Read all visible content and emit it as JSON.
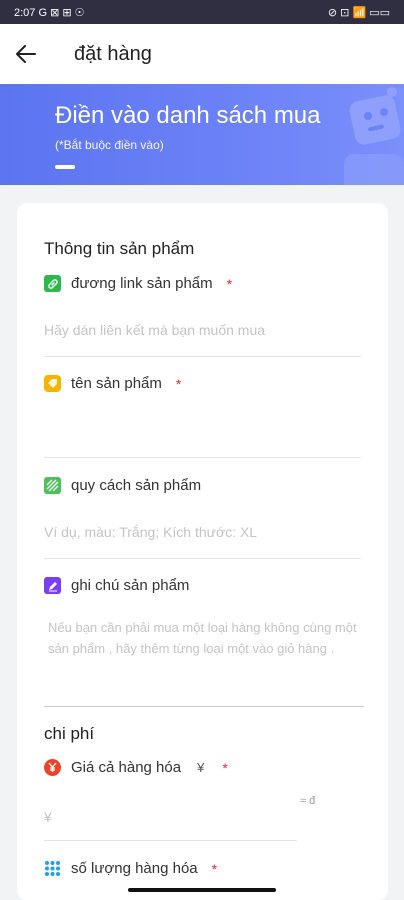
{
  "status_bar": {
    "left": "2:07 G ⊠ ⊞ ☉",
    "right": "⊘ ⊡ 📶 ▭▭"
  },
  "header": {
    "title": "đặt hàng"
  },
  "banner": {
    "title": "Điền vào danh sách mua",
    "subtitle": "(*Bắt buộc điền vào)"
  },
  "product_section": {
    "title": "Thông tin sản phẩm",
    "link": {
      "label": "đương link sản phẩm",
      "required": "*",
      "placeholder": "Hãy dán liên kết mà bạn muốn mua"
    },
    "name": {
      "label": "tên sản phẩm",
      "required": "*",
      "value": ""
    },
    "spec": {
      "label": "quy cách sản phẩm",
      "placeholder": "Ví dụ, màu: Trắng; Kích thước: XL"
    },
    "note": {
      "label": "ghi chú sản phẩm",
      "placeholder": "Nếu bạn cần phải mua một loại hàng không cùng một sản phẩm , hãy thêm từng loại một vào giỏ hàng ."
    }
  },
  "cost_section": {
    "title": "chi phí",
    "price": {
      "label": "Giá cả hàng hóa",
      "currency": "¥",
      "required": "*",
      "placeholder": "¥",
      "approx": "≈ đ"
    },
    "quantity": {
      "label": "số lượng hàng hóa",
      "required": "*"
    }
  },
  "colors": {
    "banner": "#6c82f7",
    "link_icon": "#2db84d",
    "name_icon": "#f5b400",
    "spec_icon": "#4cc05a",
    "note_icon": "#7b3ff2",
    "price_icon": "#e8452c",
    "qty_icon": "#1aa3e8",
    "required": "#ee2233"
  }
}
